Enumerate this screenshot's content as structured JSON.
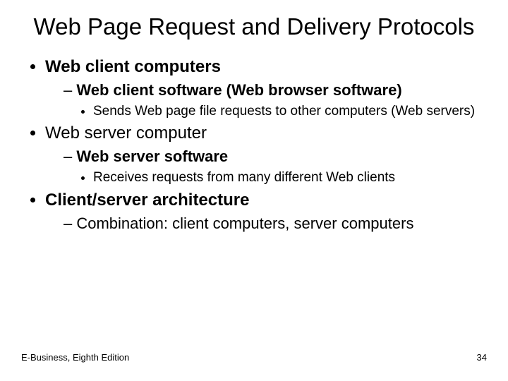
{
  "title": "Web Page Request and Delivery Protocols",
  "bullets": [
    {
      "text": "Web client computers",
      "bold": true,
      "children": [
        {
          "text": "Web client software (Web browser software)",
          "bold": true,
          "children": [
            {
              "text": "Sends Web page file requests to other computers (Web servers)"
            }
          ]
        }
      ]
    },
    {
      "text": "Web server computer",
      "bold": false,
      "children": [
        {
          "text": "Web server software",
          "bold": true,
          "children": [
            {
              "text": "Receives requests from many different Web clients"
            }
          ]
        }
      ]
    },
    {
      "text": "Client/server architecture",
      "bold": true,
      "children": [
        {
          "text": "Combination: client computers, server computers",
          "bold": false
        }
      ]
    }
  ],
  "footer": {
    "left": "E-Business, Eighth Edition",
    "right": "34"
  }
}
